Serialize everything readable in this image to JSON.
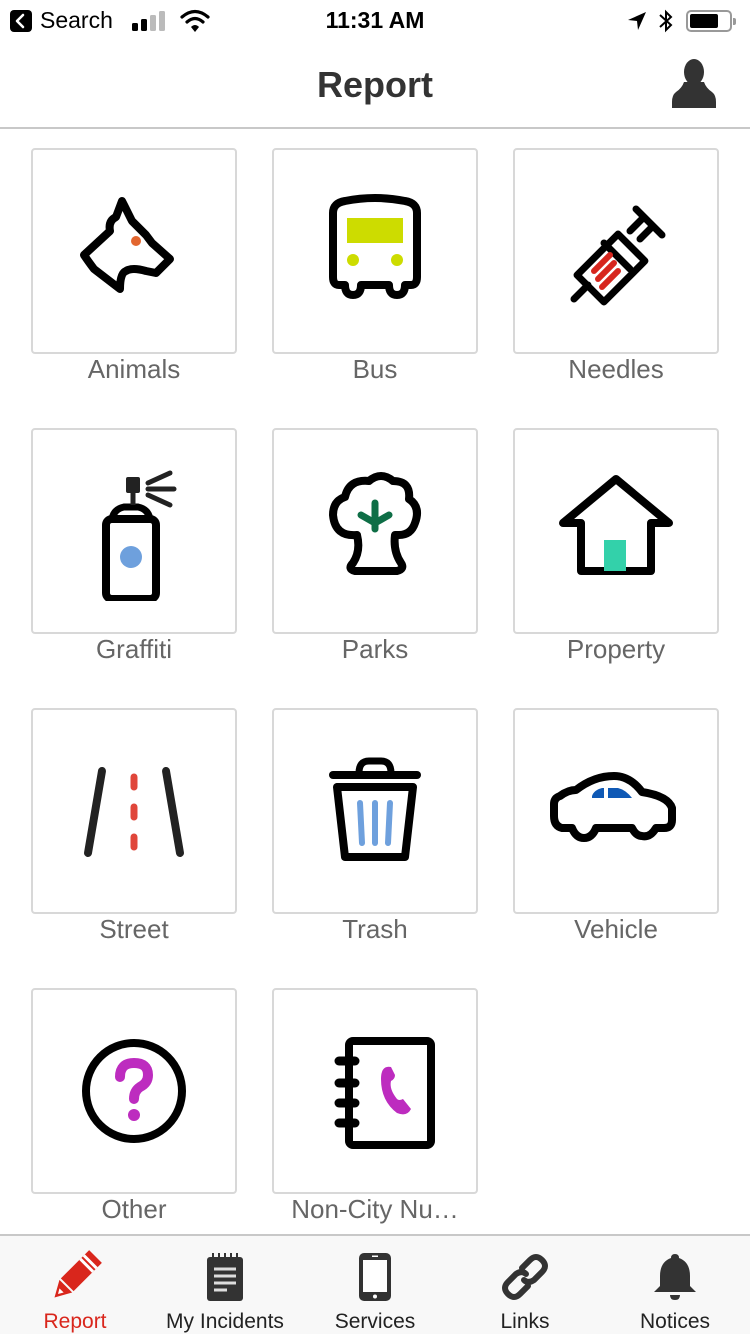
{
  "status_bar": {
    "back_app": "Search",
    "time": "11:31 AM",
    "icons": [
      "back-arrow-icon",
      "signal-icon",
      "wifi-icon",
      "location-arrow-icon",
      "bluetooth-icon",
      "battery-icon"
    ]
  },
  "nav": {
    "title": "Report",
    "right_icon": "profile-icon"
  },
  "categories": [
    {
      "label": "Animals",
      "icon": "dog-icon",
      "accent": "#e2662f"
    },
    {
      "label": "Bus",
      "icon": "bus-icon",
      "accent": "#cddc00"
    },
    {
      "label": "Needles",
      "icon": "syringe-icon",
      "accent": "#d7261e"
    },
    {
      "label": "Graffiti",
      "icon": "spray-can-icon",
      "accent": "#6ea0dd"
    },
    {
      "label": "Parks",
      "icon": "tree-icon",
      "accent": "#0e6e46"
    },
    {
      "label": "Property",
      "icon": "house-icon",
      "accent": "#33d1aa"
    },
    {
      "label": "Street",
      "icon": "road-icon",
      "accent": "#e0463a"
    },
    {
      "label": "Trash",
      "icon": "trash-can-icon",
      "accent": "#6ea0dd"
    },
    {
      "label": "Vehicle",
      "icon": "car-icon",
      "accent": "#0f59b5"
    },
    {
      "label": "Other",
      "icon": "question-icon",
      "accent": "#bd2cbf"
    },
    {
      "label": "Non-City Nu…",
      "icon": "phone-book-icon",
      "accent": "#bd2cbf"
    }
  ],
  "tabs": [
    {
      "label": "Report",
      "icon": "pencil-icon",
      "active": true
    },
    {
      "label": "My Incidents",
      "icon": "notepad-icon",
      "active": false
    },
    {
      "label": "Services",
      "icon": "smartphone-icon",
      "active": false
    },
    {
      "label": "Links",
      "icon": "link-icon",
      "active": false
    },
    {
      "label": "Notices",
      "icon": "bell-icon",
      "active": false
    }
  ],
  "colors": {
    "active_tab": "#d9261c",
    "label_gray": "#666666",
    "tile_border": "#d8d8d8"
  }
}
